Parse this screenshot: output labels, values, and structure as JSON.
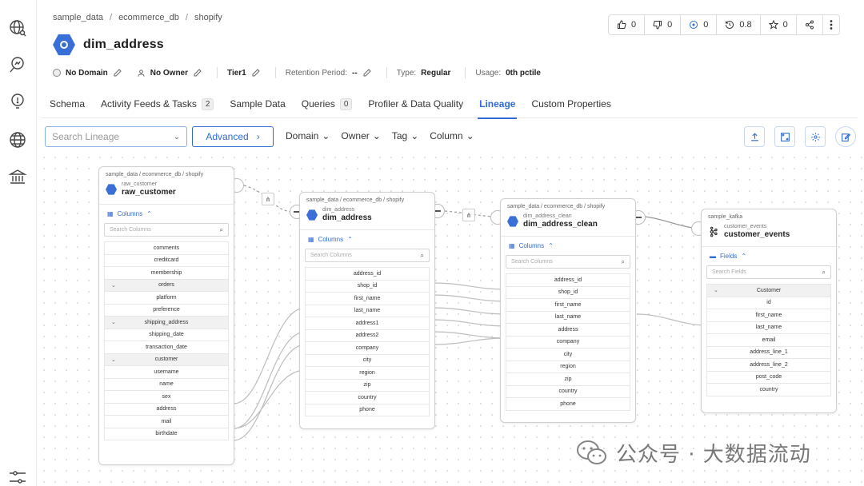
{
  "breadcrumb": [
    "sample_data",
    "ecommerce_db",
    "shopify"
  ],
  "page_title": "dim_address",
  "meta": {
    "domain": "No Domain",
    "owner": "No Owner",
    "tier": "Tier1",
    "retention_label": "Retention Period:",
    "retention_value": "--",
    "type_label": "Type:",
    "type_value": "Regular",
    "usage_label": "Usage:",
    "usage_value": "0th pctile"
  },
  "stats": {
    "upvotes": "0",
    "downvotes": "0",
    "followers": "0",
    "version": "0.8",
    "stars": "0"
  },
  "tabs": [
    {
      "label": "Schema"
    },
    {
      "label": "Activity Feeds & Tasks",
      "count": "2"
    },
    {
      "label": "Sample Data"
    },
    {
      "label": "Queries",
      "count": "0"
    },
    {
      "label": "Profiler & Data Quality"
    },
    {
      "label": "Lineage",
      "active": true
    },
    {
      "label": "Custom Properties"
    }
  ],
  "toolbar": {
    "search_placeholder": "Search Lineage",
    "advanced_label": "Advanced",
    "filters": [
      "Domain",
      "Owner",
      "Tag",
      "Column"
    ]
  },
  "nodes": {
    "raw_customer": {
      "path": "sample_data / ecommerce_db / shopify",
      "sub": "raw_customer",
      "name": "raw_customer",
      "section": "Columns",
      "search": "Search Columns",
      "rows": [
        "comments",
        "creditcard",
        "membership",
        "orders",
        "platform",
        "preference",
        "shipping_address",
        "shipping_date",
        "transaction_date",
        "customer",
        "username",
        "name",
        "sex",
        "address",
        "mail",
        "birthdate"
      ]
    },
    "dim_address": {
      "path": "sample_data / ecommerce_db / shopify",
      "sub": "dim_address",
      "name": "dim_address",
      "section": "Columns",
      "search": "Search Columns",
      "rows": [
        "address_id",
        "shop_id",
        "first_name",
        "last_name",
        "address1",
        "address2",
        "company",
        "city",
        "region",
        "zip",
        "country",
        "phone"
      ]
    },
    "dim_address_clean": {
      "path": "sample_data / ecommerce_db / shopify",
      "sub": "dim_address_clean",
      "name": "dim_address_clean",
      "section": "Columns",
      "search": "Search Columns",
      "rows": [
        "address_id",
        "shop_id",
        "first_name",
        "last_name",
        "address",
        "company",
        "city",
        "region",
        "zip",
        "country",
        "phone"
      ]
    },
    "customer_events": {
      "path": "sample_kafka",
      "sub": "customer_events",
      "name": "customer_events",
      "section": "Fields",
      "search": "Search Fields",
      "rows": [
        "Customer",
        "id",
        "first_name",
        "last_name",
        "email",
        "address_line_1",
        "address_line_2",
        "post_code",
        "country"
      ]
    }
  },
  "watermark": "公众号 · 大数据流动",
  "colors": {
    "accent": "#2f6bd6",
    "hex_icon": "#3b6fd8"
  }
}
